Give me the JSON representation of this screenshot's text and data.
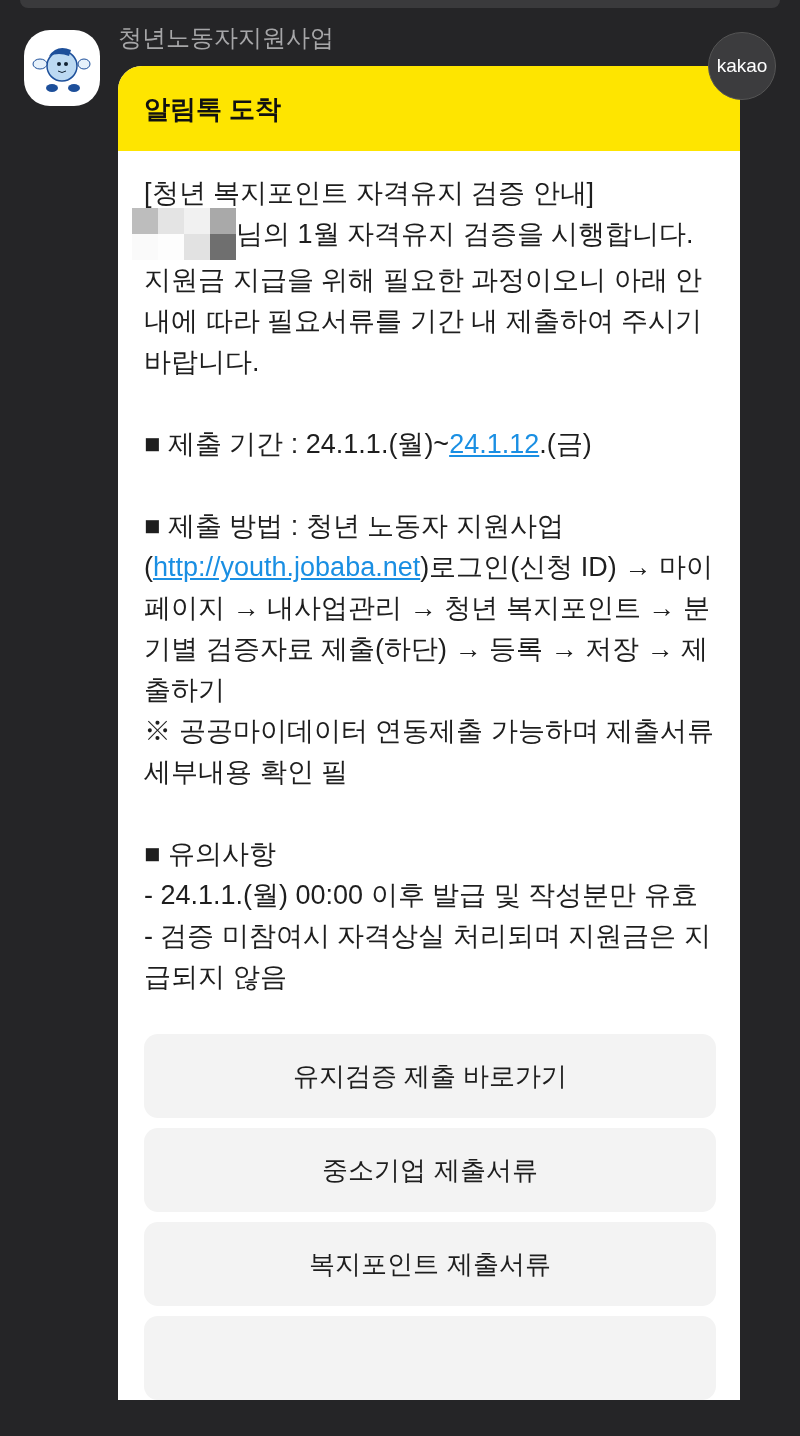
{
  "sender": {
    "name": "청년노동자지원사업"
  },
  "badge": "kakao",
  "card": {
    "header": "알림톡 도착",
    "title": "[청년 복지포인트 자격유지 검증 안내]",
    "paragraphs": [
      {
        "kind": "redacted",
        "parts": [
          {
            "text": "님의 1월 자격유지 검증을 시행합니다.",
            "kind": "text"
          }
        ]
      },
      {
        "kind": "text",
        "parts": [
          {
            "text": "지원금 지급을 위해 필요한 과정이오니 아래 안내에 따라 필요서류를 기간 내 제출하여 주시기 바랍니다.",
            "kind": "text"
          }
        ]
      },
      {
        "kind": "gap"
      },
      {
        "kind": "text",
        "parts": [
          {
            "text": "■ 제출 기간 : 24.1.1.(월)~",
            "kind": "text"
          },
          {
            "text": "24.1.12",
            "kind": "link"
          },
          {
            "text": ".(금)",
            "kind": "text"
          }
        ]
      },
      {
        "kind": "gap"
      },
      {
        "kind": "text",
        "parts": [
          {
            "text": "■ 제출 방법 : 청년 노동자 지원사업(",
            "kind": "text"
          },
          {
            "text": "http://youth.jobaba.net",
            "kind": "link"
          },
          {
            "text": ")로그인(신청 ID) → 마이페이지 → 내사업관리 → 청년 복지포인트 → 분기별 검증자료 제출(하단) → 등록 → 저장 → 제출하기",
            "kind": "text"
          }
        ]
      },
      {
        "kind": "text",
        "parts": [
          {
            "text": "※ 공공마이데이터 연동제출 가능하며 제출서류 세부내용 확인 필",
            "kind": "text"
          }
        ]
      },
      {
        "kind": "gap"
      },
      {
        "kind": "text",
        "parts": [
          {
            "text": "■ 유의사항",
            "kind": "text"
          }
        ]
      },
      {
        "kind": "text",
        "parts": [
          {
            "text": "- 24.1.1.(월) 00:00 이후 발급 및 작성분만 유효",
            "kind": "text"
          }
        ]
      },
      {
        "kind": "text",
        "parts": [
          {
            "text": "- 검증 미참여시 자격상실 처리되며 지원금은 지급되지 않음",
            "kind": "text"
          }
        ]
      }
    ],
    "buttons": [
      "유지검증 제출 바로가기",
      "중소기업 제출서류",
      "복지포인트 제출서류"
    ]
  }
}
